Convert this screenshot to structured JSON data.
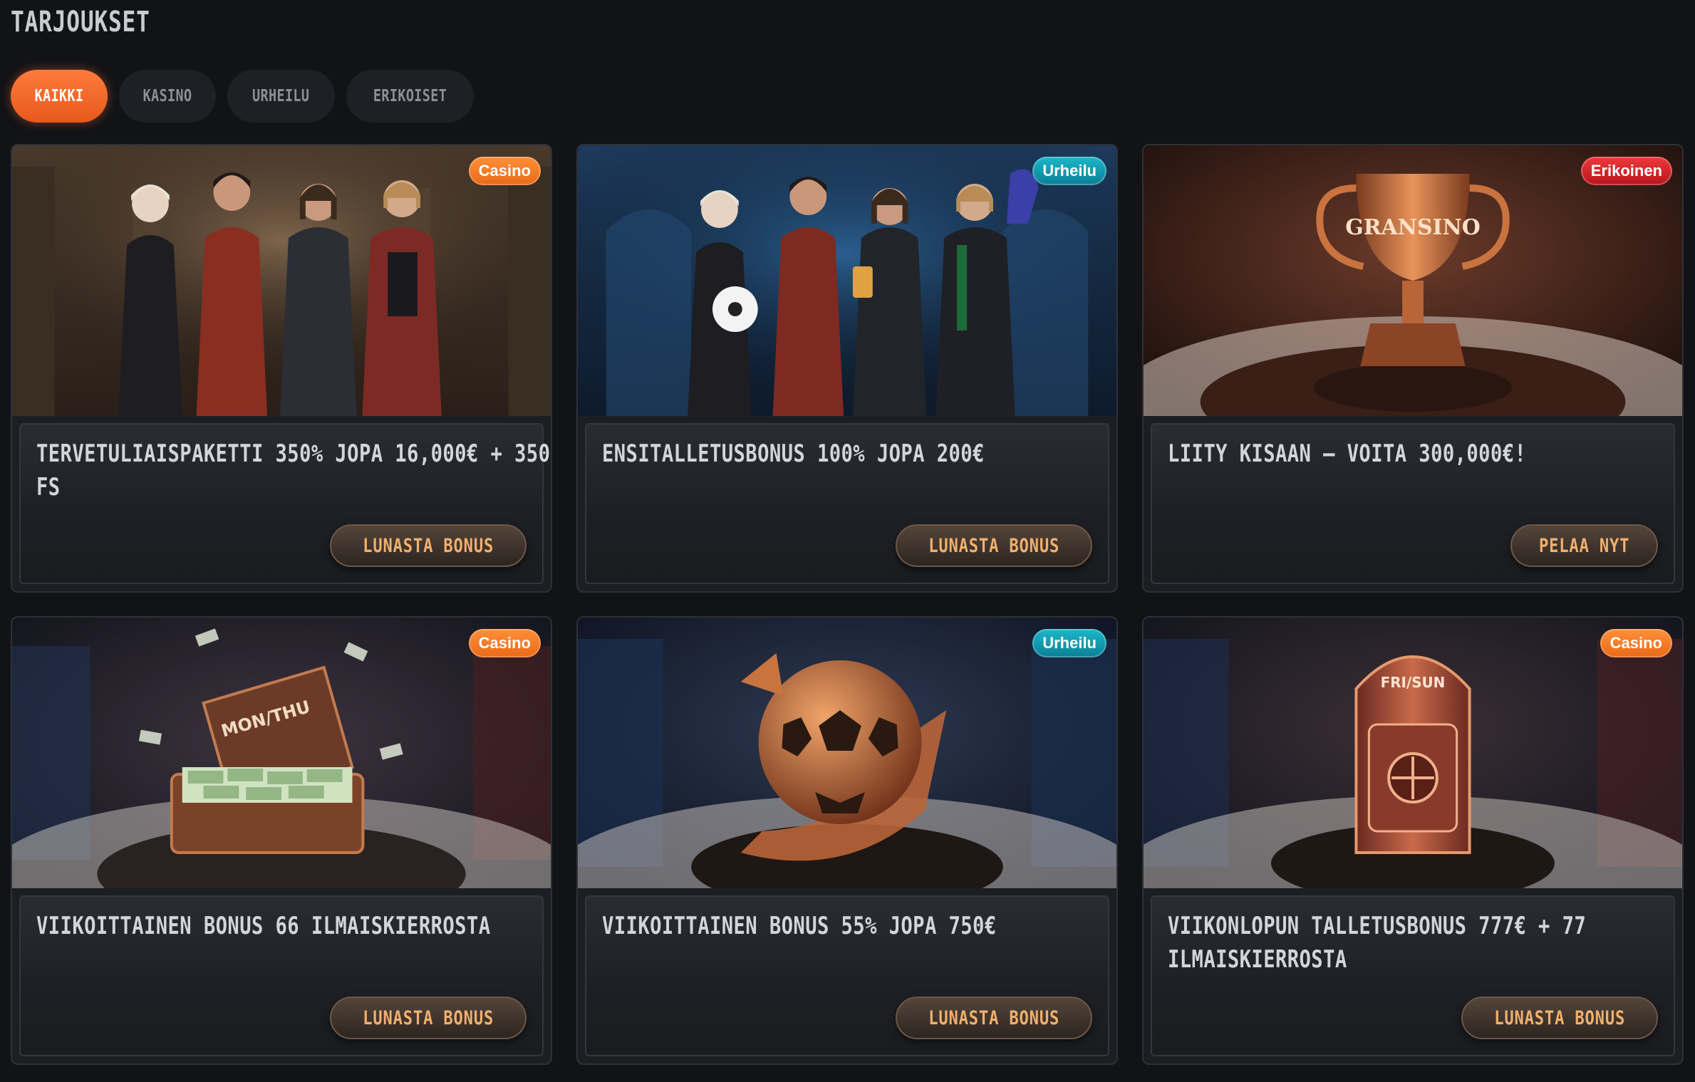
{
  "page": {
    "title": "TARJOUKSET"
  },
  "filters": [
    {
      "label": "KAIKKI",
      "active": true
    },
    {
      "label": "KASINO",
      "active": false
    },
    {
      "label": "URHEILU",
      "active": false
    },
    {
      "label": "ERIKOISET",
      "active": false
    }
  ],
  "cards": [
    {
      "badge": "Casino",
      "title": "TERVETULIAISPAKETTI 350% JOPA 16,000€ + 350 FS",
      "button": "LUNASTA BONUS",
      "image": "characters-casino-lobby"
    },
    {
      "badge": "Urheilu",
      "title": "ENSITALLETUSBONUS 100% JOPA 200€",
      "button": "LUNASTA BONUS",
      "image": "characters-sports-bar"
    },
    {
      "badge": "Erikoinen",
      "title": "LIITY KISAAN – VOITA 300,000€!",
      "button": "PELAA NYT",
      "image": "gransino-trophy",
      "trophy_label": "GRANSINO"
    },
    {
      "badge": "Casino",
      "title": "VIIKOITTAINEN BONUS 66 ILMAISKIERROSTA",
      "button": "LUNASTA BONUS",
      "image": "money-suitcase",
      "case_label": "MON/THU"
    },
    {
      "badge": "Urheilu",
      "title": "VIIKOITTAINEN BONUS 55% JOPA 750€",
      "button": "LUNASTA BONUS",
      "image": "soccer-ball-arrow"
    },
    {
      "badge": "Casino",
      "title": "VIIKONLOPUN TALLETUSBONUS 777€ + 77 ILMAISKIERROSTA",
      "button": "LUNASTA BONUS",
      "image": "slot-safe",
      "safe_label": "FRI/SUN"
    }
  ],
  "colors": {
    "background": "#121317",
    "accent": "#f26b2a",
    "cta_text": "#f0b06e",
    "badge_casino": "#f07a22",
    "badge_urheilu": "#139cb2",
    "badge_erikoinen": "#d6222a"
  }
}
